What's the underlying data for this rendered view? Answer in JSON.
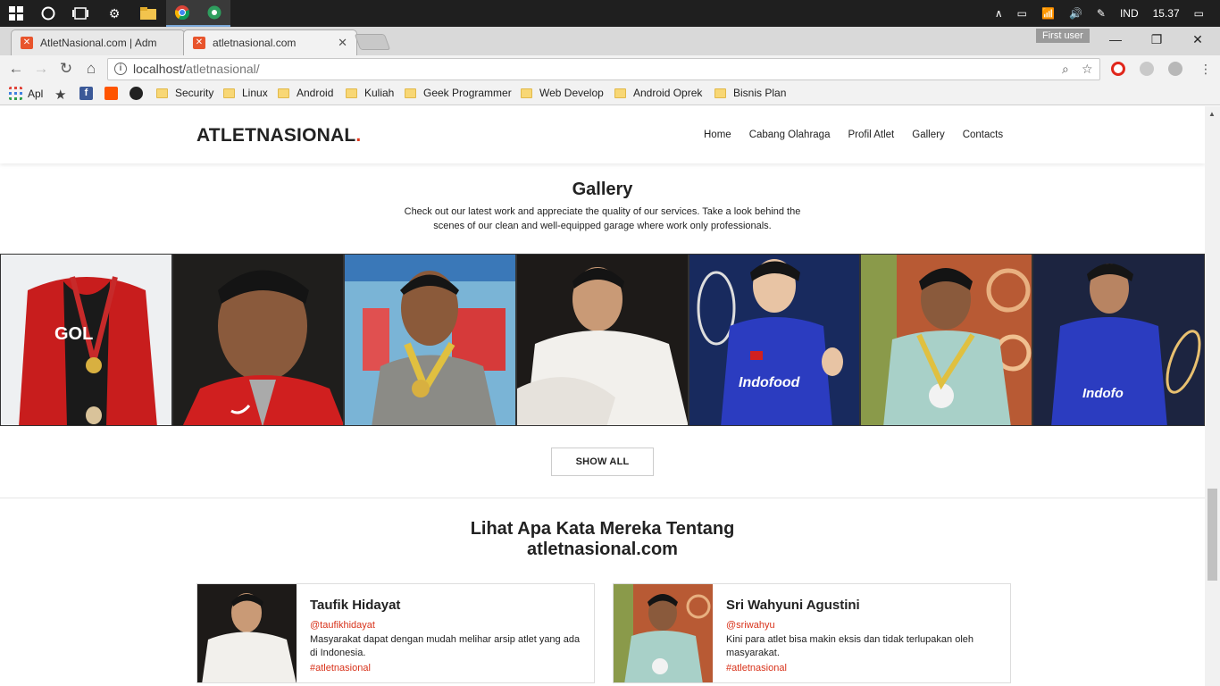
{
  "taskbar": {
    "tray": [
      "IND",
      "15.37"
    ]
  },
  "browser": {
    "tabs": [
      {
        "title": "AtletNasional.com | Adm",
        "active": false
      },
      {
        "title": "atletnasional.com",
        "active": true
      }
    ],
    "profile_label": "First user",
    "url_host": "localhost/",
    "url_path": "atletnasional/",
    "bookmarks": [
      "Apl",
      "Security",
      "Linux",
      "Android",
      "Kuliah",
      "Geek Programmer",
      "Web Develop",
      "Android Oprek",
      "Bisnis Plan"
    ]
  },
  "site": {
    "logo": "ATLETNASIONAL",
    "logo_dot": ".",
    "nav": [
      "Home",
      "Cabang Olahraga",
      "Profil Atlet",
      "Gallery",
      "Contacts"
    ],
    "gallery": {
      "title": "Gallery",
      "subtitle": "Check out our latest work and appreciate the quality of our services. Take a look behind the scenes of our clean and well-equipped garage where work only professionals.",
      "show_all": "SHOW ALL"
    },
    "testimonials": {
      "title_line1": "Lihat Apa Kata Mereka Tentang",
      "title_line2": "atletnasional.com",
      "cards": [
        {
          "name": "Taufik Hidayat",
          "handle": "@taufikhidayat",
          "text": "Masyarakat dapat dengan mudah melihar arsip atlet yang ada di Indonesia.",
          "tag": "#atletnasional"
        },
        {
          "name": "Sri Wahyuni Agustini",
          "handle": "@sriwahyu",
          "text": "Kini para atlet bisa makin eksis dan tidak terlupakan oleh masyarakat.",
          "tag": "#atletnasional"
        }
      ]
    }
  },
  "colors": {
    "accent": "#e23a1f",
    "link_red": "#d8321a"
  }
}
